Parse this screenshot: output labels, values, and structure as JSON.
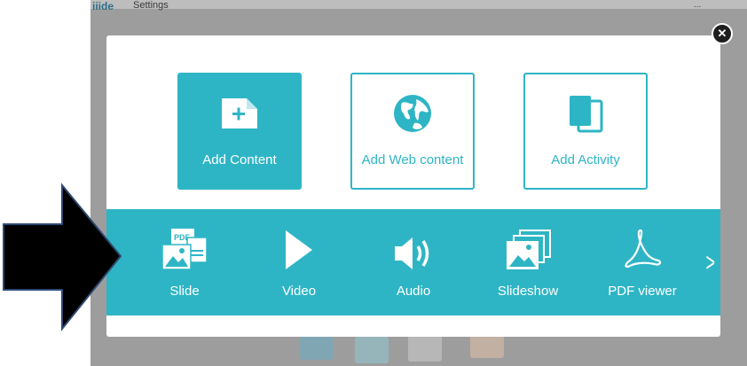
{
  "background": {
    "tab_label": "iiide",
    "settings_label": "Settings",
    "right_text": "..."
  },
  "modal": {
    "close_icon": "close-icon",
    "cards": [
      {
        "label": "Add Content",
        "icon": "add-content-icon"
      },
      {
        "label": "Add Web content",
        "icon": "globe-icon"
      },
      {
        "label": "Add Activity",
        "icon": "activity-icon"
      }
    ],
    "tools": [
      {
        "label": "Slide",
        "icon": "slide-icon"
      },
      {
        "label": "Video",
        "icon": "play-icon"
      },
      {
        "label": "Audio",
        "icon": "speaker-icon"
      },
      {
        "label": "Slideshow",
        "icon": "slideshow-icon"
      },
      {
        "label": "PDF viewer",
        "icon": "pdf-icon"
      }
    ],
    "next_icon": "chevron-right-icon"
  },
  "colors": {
    "accent": "#2eb5c5",
    "arrow": "#000000",
    "arrow_border": "#2f4a73"
  },
  "annotation": {
    "icon": "arrow-right-icon"
  }
}
